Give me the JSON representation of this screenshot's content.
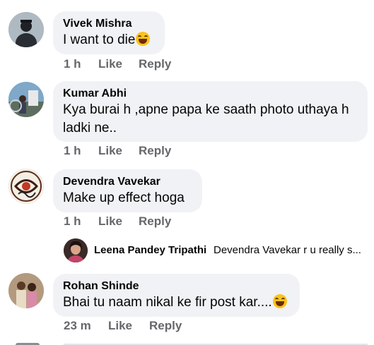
{
  "comments": [
    {
      "name": "Vivek Mishra",
      "text": "I want to die",
      "emoji": "laughing-emoji",
      "time": "1 h",
      "like": "Like",
      "reply": "Reply"
    },
    {
      "name": "Kumar Abhi",
      "text": "Kya burai h ,apne papa ke saath photo uthaya h ladki ne..",
      "time": "1 h",
      "like": "Like",
      "reply": "Reply"
    },
    {
      "name": "Devendra Vavekar",
      "text": "Make up effect hoga",
      "time": "1 h",
      "like": "Like",
      "reply": "Reply"
    },
    {
      "name": "Rohan Shinde",
      "text": "Bhai tu naam nikal ke fir post kar....",
      "emoji": "laughing-emoji",
      "time": "23 m",
      "like": "Like",
      "reply": "Reply"
    }
  ],
  "reply_preview": {
    "name": "Leena Pandey Tripathi",
    "text": "Devendra Vavekar r u really s..."
  }
}
